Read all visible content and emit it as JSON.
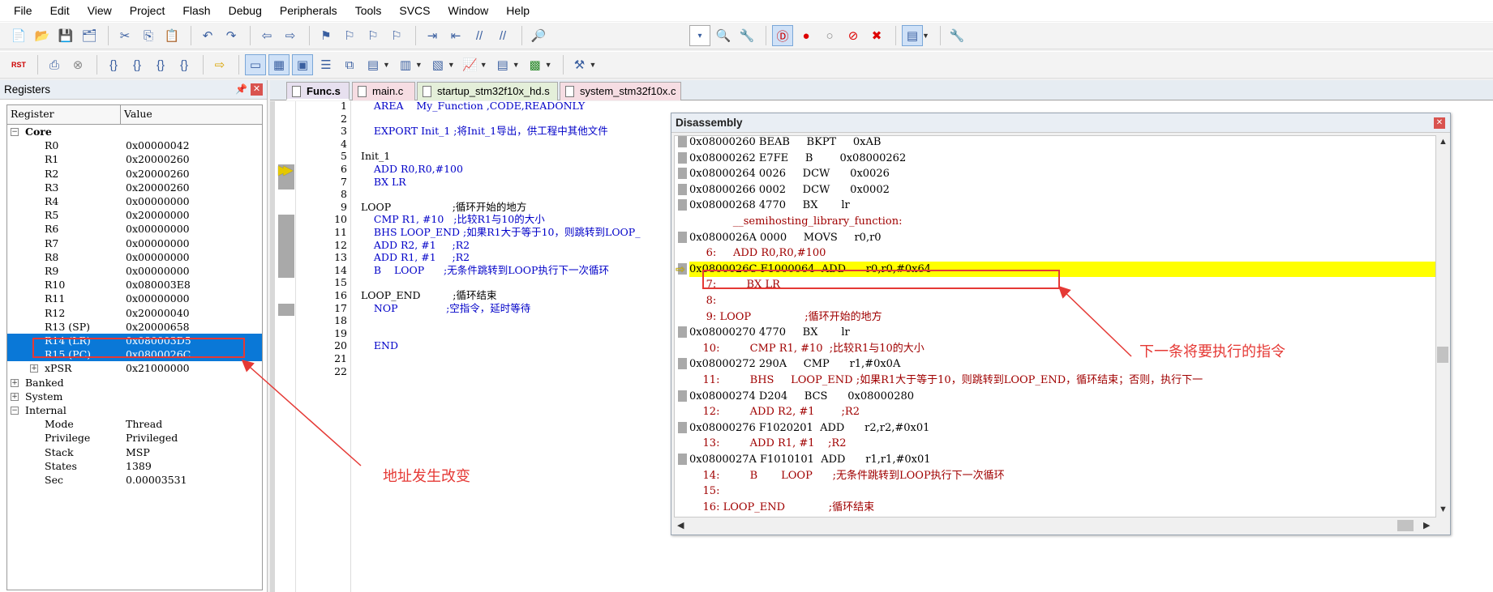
{
  "menu": [
    "File",
    "Edit",
    "View",
    "Project",
    "Flash",
    "Debug",
    "Peripherals",
    "Tools",
    "SVCS",
    "Window",
    "Help"
  ],
  "registers": {
    "title": "Registers",
    "col_register": "Register",
    "col_value": "Value",
    "core_label": "Core",
    "core": [
      {
        "name": "R0",
        "value": "0x00000042"
      },
      {
        "name": "R1",
        "value": "0x20000260"
      },
      {
        "name": "R2",
        "value": "0x20000260"
      },
      {
        "name": "R3",
        "value": "0x20000260"
      },
      {
        "name": "R4",
        "value": "0x00000000"
      },
      {
        "name": "R5",
        "value": "0x20000000"
      },
      {
        "name": "R6",
        "value": "0x00000000"
      },
      {
        "name": "R7",
        "value": "0x00000000"
      },
      {
        "name": "R8",
        "value": "0x00000000"
      },
      {
        "name": "R9",
        "value": "0x00000000"
      },
      {
        "name": "R10",
        "value": "0x080003E8"
      },
      {
        "name": "R11",
        "value": "0x00000000"
      },
      {
        "name": "R12",
        "value": "0x20000040"
      },
      {
        "name": "R13 (SP)",
        "value": "0x20000658"
      },
      {
        "name": "R14 (LR)",
        "value": "0x080003D5"
      },
      {
        "name": "R15 (PC)",
        "value": "0x0800026C"
      },
      {
        "name": "xPSR",
        "value": "0x21000000"
      }
    ],
    "banked_label": "Banked",
    "system_label": "System",
    "internal_label": "Internal",
    "internal": [
      {
        "name": "Mode",
        "value": "Thread"
      },
      {
        "name": "Privilege",
        "value": "Privileged"
      },
      {
        "name": "Stack",
        "value": "MSP"
      },
      {
        "name": "States",
        "value": "1389"
      },
      {
        "name": "Sec",
        "value": "0.00003531"
      }
    ]
  },
  "tabs": [
    {
      "label": "Func.s",
      "active": true,
      "color": "#e7e0ef"
    },
    {
      "label": "main.c",
      "active": false,
      "color": "#f6dde3"
    },
    {
      "label": "startup_stm32f10x_hd.s",
      "active": false,
      "color": "#e4efd9"
    },
    {
      "label": "system_stm32f10x.c",
      "active": false,
      "color": "#f6dde3"
    }
  ],
  "editor": {
    "line_numbers": [
      "1",
      "2",
      "3",
      "4",
      "5",
      "6",
      "7",
      "8",
      "9",
      "10",
      "11",
      "12",
      "13",
      "14",
      "15",
      "16",
      "17",
      "18",
      "19",
      "20",
      "21",
      "22"
    ],
    "lines": [
      "    AREA    My_Function ,CODE,READONLY",
      "",
      "    EXPORT Init_1 ;将Init_1导出，供工程中其他文件",
      "",
      "Init_1",
      "    ADD R0,R0,#100",
      "    BX LR",
      "",
      "LOOP                   ;循环开始的地方",
      "    CMP R1, #10   ;比较R1与10的大小",
      "    BHS LOOP_END ;如果R1大于等于10，则跳转到LOOP_",
      "    ADD R2, #1     ;R2",
      "    ADD R1, #1     ;R2",
      "    B    LOOP      ;无条件跳转到LOOP执行下一次循环",
      "",
      "LOOP_END          ;循环结束",
      "    NOP               ;空指令，延时等待",
      "",
      "",
      "    END",
      "",
      ""
    ]
  },
  "disassembly": {
    "title": "Disassembly",
    "lines": [
      "0x08000260 BEAB     BKPT     0xAB",
      "0x08000262 E7FE     B        0x08000262",
      "0x08000264 0026     DCW      0x0026",
      "0x08000266 0002     DCW      0x0002",
      "0x08000268 4770     BX       lr",
      "             __semihosting_library_function:",
      "0x0800026A 0000     MOVS     r0,r0",
      "     6:     ADD R0,R0,#100",
      "0x0800026C F1000064  ADD      r0,r0,#0x64",
      "     7:         BX LR",
      "     8:",
      "     9: LOOP                ;循环开始的地方",
      "0x08000270 4770     BX       lr",
      "    10:         CMP R1, #10  ;比较R1与10的大小",
      "0x08000272 290A     CMP      r1,#0x0A",
      "    11:         BHS     LOOP_END ;如果R1大于等于10，则跳转到LOOP_END，循环结束；否则，执行下一",
      "0x08000274 D204     BCS      0x08000280",
      "    12:         ADD R2, #1        ;R2",
      "0x08000276 F1020201  ADD      r2,r2,#0x01",
      "    13:         ADD R1, #1    ;R2",
      "0x0800027A F1010101  ADD      r1,r1,#0x01",
      "    14:         B       LOOP      ;无条件跳转到LOOP执行下一次循环",
      "    15:",
      "    16: LOOP_END             ;循环结束"
    ]
  },
  "annotations": {
    "next_instruction": "下一条将要执行的指令",
    "address_changed": "地址发生改变"
  },
  "colors": {
    "accent": "#e53935",
    "highlight": "#ffff00",
    "selection": "#0a78d7"
  }
}
